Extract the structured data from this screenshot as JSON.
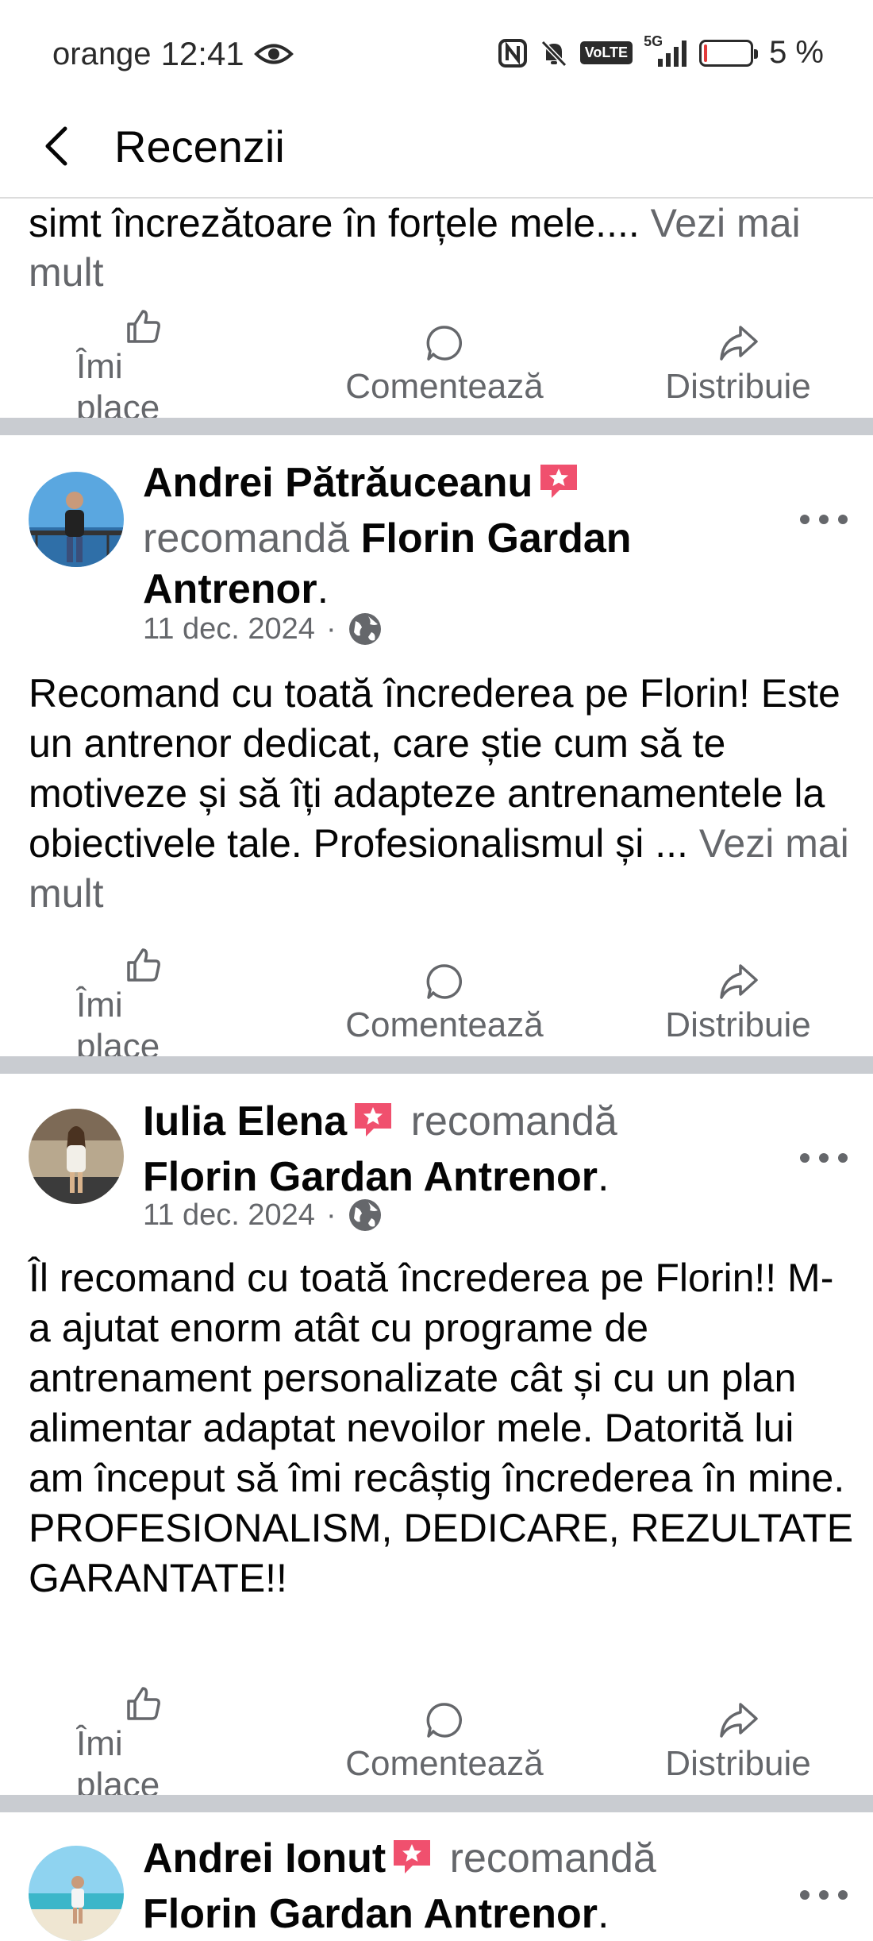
{
  "status_bar": {
    "carrier": "orange",
    "time": "12:41",
    "network_type": "5G",
    "volte": "VoLTE",
    "battery_percent": "5 %",
    "battery_level": 0.05
  },
  "header": {
    "title": "Recenzii"
  },
  "previous_post": {
    "text_tail": "simt încrezătoare în forțele mele.... ",
    "see_more": "Vezi mai mult"
  },
  "actions": {
    "like": "Îmi place",
    "comment": "Comentează",
    "share": "Distribuie"
  },
  "posts": [
    {
      "author": "Andrei Pătrăuceanu",
      "verb": "recomandă",
      "page": "Florin Gardan Antrenor",
      "date": "11 dec. 2024",
      "text": "Recomand cu toată încrederea pe Florin! Este un antrenor dedicat, care știe cum să te motiveze și să îți adapteze antrenamentele la obiectivele tale. Profesionalismul și ... ",
      "see_more": "Vezi mai mult"
    },
    {
      "author": "Iulia Elena",
      "verb": "recomandă",
      "page": "Florin Gardan Antrenor",
      "date": "11 dec. 2024",
      "text": "Îl recomand cu toată încrederea pe Florin!! M-a ajutat enorm atât cu programe de antrenament personalizate cât și cu un plan alimentar adaptat nevoilor mele. Datorită lui am început să îmi recâștig încrederea în mine. PROFESIONALISM, DEDICARE, REZULTATE GARANTATE!!"
    },
    {
      "author": "Andrei Ionut",
      "verb": "recomandă",
      "page": "Florin Gardan Antrenor"
    }
  ],
  "colors": {
    "separator": "#c9ccd1",
    "secondary_text": "#65676b",
    "badge": "#f0506e"
  }
}
